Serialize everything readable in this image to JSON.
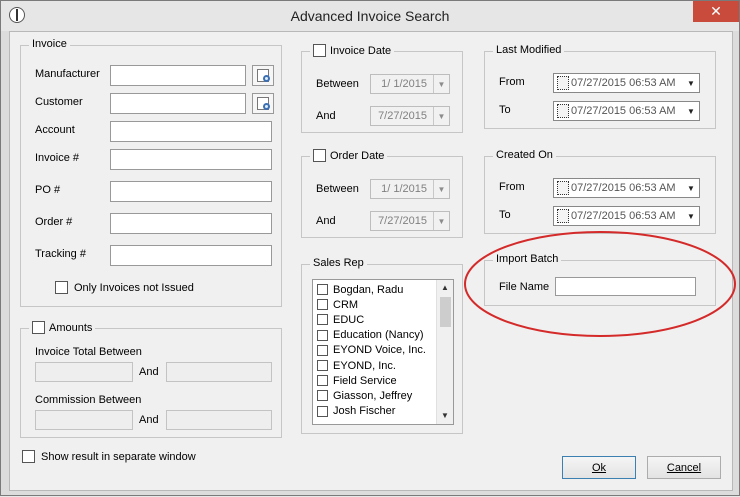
{
  "window": {
    "title": "Advanced Invoice Search",
    "close_glyph": "✕",
    "app_icon": "compass-icon"
  },
  "invoice": {
    "title": "Invoice",
    "manufacturer_label": "Manufacturer",
    "customer_label": "Customer",
    "account_label": "Account",
    "invoice_no_label": "Invoice #",
    "po_label": "PO #",
    "order_label": "Order #",
    "tracking_label": "Tracking #",
    "only_not_issued_label": "Only Invoices not Issued",
    "lookup_icon": "lookup-icon"
  },
  "invoice_date": {
    "title": "Invoice Date",
    "between_label": "Between",
    "and_label": "And",
    "from_value": "1/  1/2015",
    "to_value": "7/27/2015"
  },
  "order_date": {
    "title": "Order Date",
    "between_label": "Between",
    "and_label": "And",
    "from_value": "1/  1/2015",
    "to_value": "7/27/2015"
  },
  "last_modified": {
    "title": "Last Modified",
    "from_label": "From",
    "to_label": "To",
    "from_value": "07/27/2015 06:53 AM",
    "to_value": "07/27/2015 06:53 AM"
  },
  "created_on": {
    "title": "Created On",
    "from_label": "From",
    "to_label": "To",
    "from_value": "07/27/2015 06:53 AM",
    "to_value": "07/27/2015 06:53 AM"
  },
  "import_batch": {
    "title": "Import Batch",
    "file_name_label": "File Name",
    "file_name_value": ""
  },
  "sales_rep": {
    "title": "Sales Rep",
    "items": [
      "Bogdan, Radu",
      "CRM",
      "EDUC",
      "Education (Nancy)",
      "EYOND Voice, Inc.",
      "EYOND, Inc.",
      "Field Service",
      "Giasson, Jeffrey",
      "Josh Fischer"
    ]
  },
  "amounts": {
    "title": "Amounts",
    "invoice_total_label": "Invoice Total Between",
    "and_label": "And",
    "commission_label": "Commission Between",
    "and2_label": "And"
  },
  "footer": {
    "show_separate_label": "Show result in separate window",
    "ok_label": "Ok",
    "cancel_label": "Cancel"
  },
  "annotation": {
    "color": "#d42a2a"
  }
}
